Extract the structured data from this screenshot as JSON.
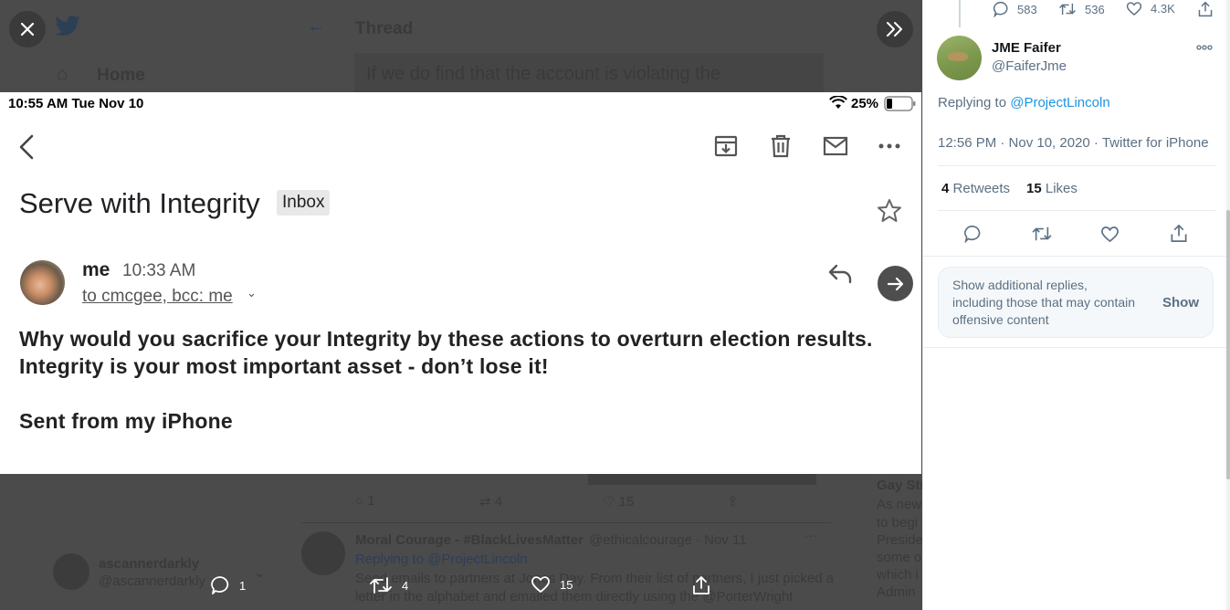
{
  "viewer": {
    "background": {
      "thread_heading": "Thread",
      "home_label": "Home",
      "search_text": "If we do find that the account is violating the",
      "left_user_name": "ascannerdarkly",
      "left_user_handle": "@ascannerdarkly",
      "tweet_counts": [
        "1",
        "4",
        "15"
      ],
      "reply_author": "Moral Courage - #BlackLivesMatter",
      "reply_handle_date": "@ethicalcourage · Nov 11",
      "reply_replying": "Replying to @ProjectLincoln",
      "reply_text_1": "Send emails to partners at Jones Day. From their list of partners, I just picked a",
      "reply_text_2": "letter in the alphabet and emailed them directly using the @PorterWright",
      "side_name": "Gay Str",
      "side_lines": [
        "As news",
        "to begi",
        "Preside",
        "some o",
        "which i",
        "Admin"
      ]
    },
    "screenshot": {
      "status_time": "10:55 AM   Tue Nov 10",
      "status_battery": "25%",
      "subject": "Serve with Integrity",
      "label": "Inbox",
      "sender": "me",
      "time": "10:33 AM",
      "recipients": "to cmcgee, bcc: me",
      "body_lines": [
        "Why would you sacrifice your Integrity by these actions to overturn election results.",
        "Integrity is your most important asset - don’t lose it!",
        "Sent from my iPhone"
      ]
    },
    "actions": {
      "reply_count": "1",
      "retweet_count": "4",
      "like_count": "15"
    }
  },
  "pane": {
    "top_stats": {
      "replies": "583",
      "retweets": "536",
      "likes": "4.3K"
    },
    "author_name": "JME Faifer",
    "author_handle": "@FaiferJme",
    "replying_prefix": "Replying to",
    "replying_to": "@ProjectLincoln",
    "timestamp": "12:56 PM · Nov 10, 2020 · Twitter for iPhone",
    "retweets_count": "4",
    "retweets_label": "Retweets",
    "likes_count": "15",
    "likes_label": "Likes",
    "notice_text": "Show additional replies, including those that may contain offensive content",
    "notice_button": "Show"
  },
  "colors": {
    "accent": "#1b95e0",
    "muted": "#5b7083",
    "overlay": "#4b4b4b"
  }
}
